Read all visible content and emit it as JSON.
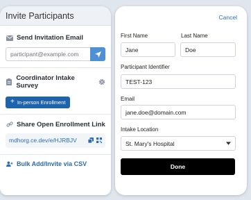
{
  "left_panel": {
    "title": "Invite Participants",
    "send_email": {
      "title": "Send Invitation Email",
      "icon": "envelope-icon",
      "placeholder": "participant@example.com"
    },
    "intake_survey": {
      "title": "Coordinator Intake Survey",
      "button_label": "In-person Enrollment"
    },
    "open_link": {
      "title": "Share Open Enrollment Link",
      "url": "mdhorg.ce.dev/e/HJRBJV"
    },
    "bulk": {
      "label": "Bulk Add/Invite via CSV"
    }
  },
  "form": {
    "cancel_label": "Cancel",
    "first_name_label": "First Name",
    "first_name_value": "Jane",
    "last_name_label": "Last Name",
    "last_name_value": "Doe",
    "participant_id_label": "Participant Identifier",
    "participant_id_value": "TEST-123",
    "email_label": "Email",
    "email_value": "jane.doe@domain.com",
    "intake_location_label": "Intake Location",
    "intake_location_value": "St. Mary's Hospital",
    "done_label": "Done"
  },
  "colors": {
    "accent": "#1f63ad",
    "link": "#2c6bb3",
    "send_button": "#4e8fd6",
    "done_button": "#000000"
  }
}
